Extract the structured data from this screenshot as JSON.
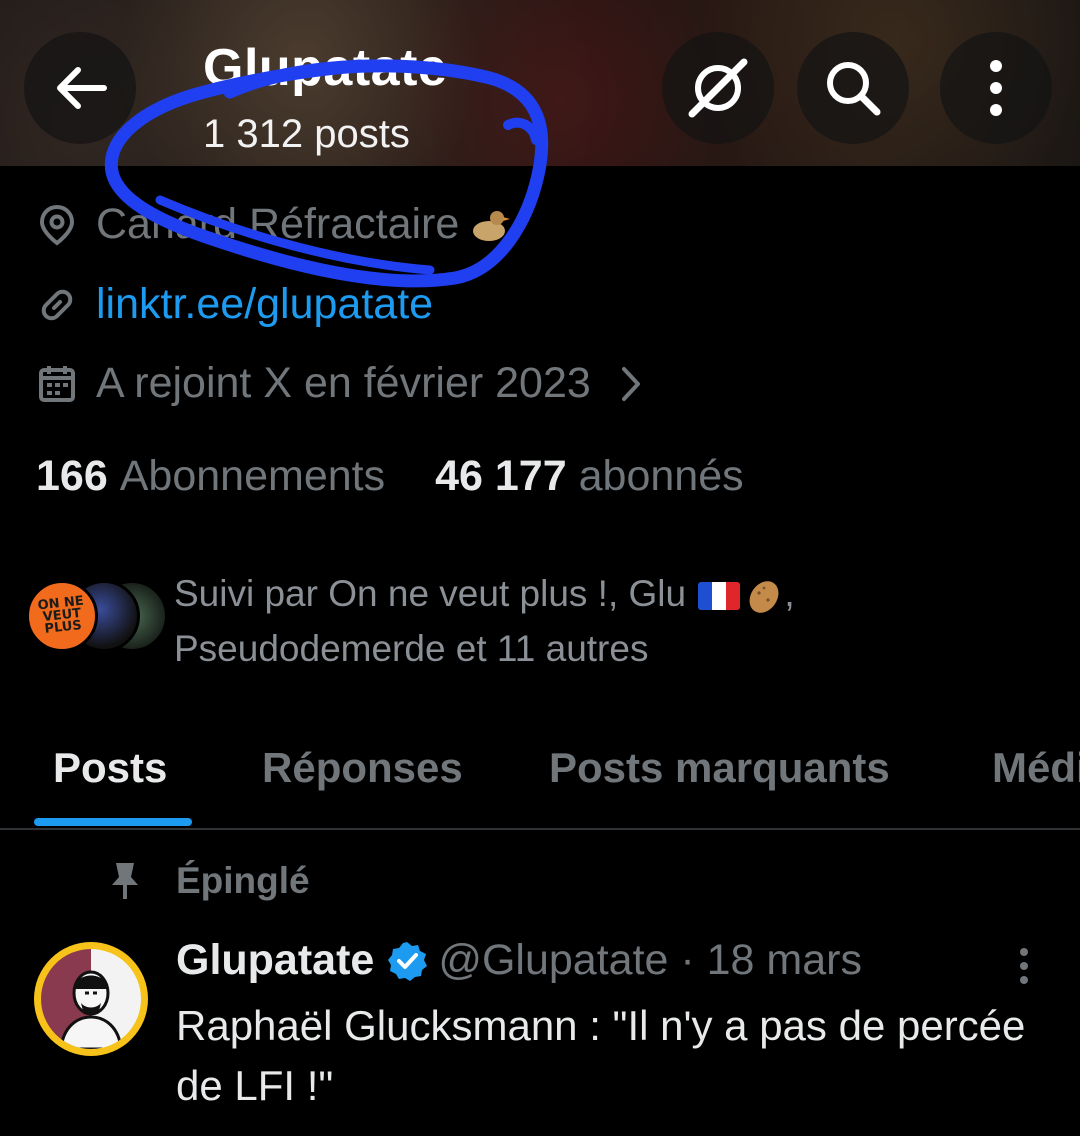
{
  "header": {
    "title": "Glupatate",
    "posts_count": "1 312 posts",
    "back_icon": "arrow-left-icon",
    "grok_icon": "grok-icon",
    "search_icon": "search-icon",
    "more_icon": "more-vertical-icon"
  },
  "profile": {
    "location": "Canard Réfractaire",
    "link": "linktr.ee/glupatate",
    "joined": "A rejoint X en février 2023",
    "following_count": "166",
    "following_label": "Abonnements",
    "followers_count": "46 177",
    "followers_label": "abonnés",
    "followed_by_line1_prefix": "Suivi par On ne veut plus !, Glu",
    "followed_by_line1_suffix": ",",
    "followed_by_line2": "Pseudodemerde et 11 autres",
    "follower_avatar_1_text": "ON NE VEUT PLUS"
  },
  "tabs": [
    {
      "label": "Posts",
      "active": true
    },
    {
      "label": "Réponses",
      "active": false
    },
    {
      "label": "Posts marquants",
      "active": false
    },
    {
      "label": "Médias",
      "active": false
    }
  ],
  "pinned_tweet": {
    "pinned_label": "Épinglé",
    "name": "Glupatate",
    "handle_date": "@Glupatate · 18 mars",
    "text": "Raphaël Glucksmann : \"Il n'y a pas de percée de LFI !\""
  },
  "colors": {
    "accent": "#1d9bf0",
    "background": "#000000",
    "secondary_text": "#71767b",
    "annotation": "#1f3ff0"
  }
}
